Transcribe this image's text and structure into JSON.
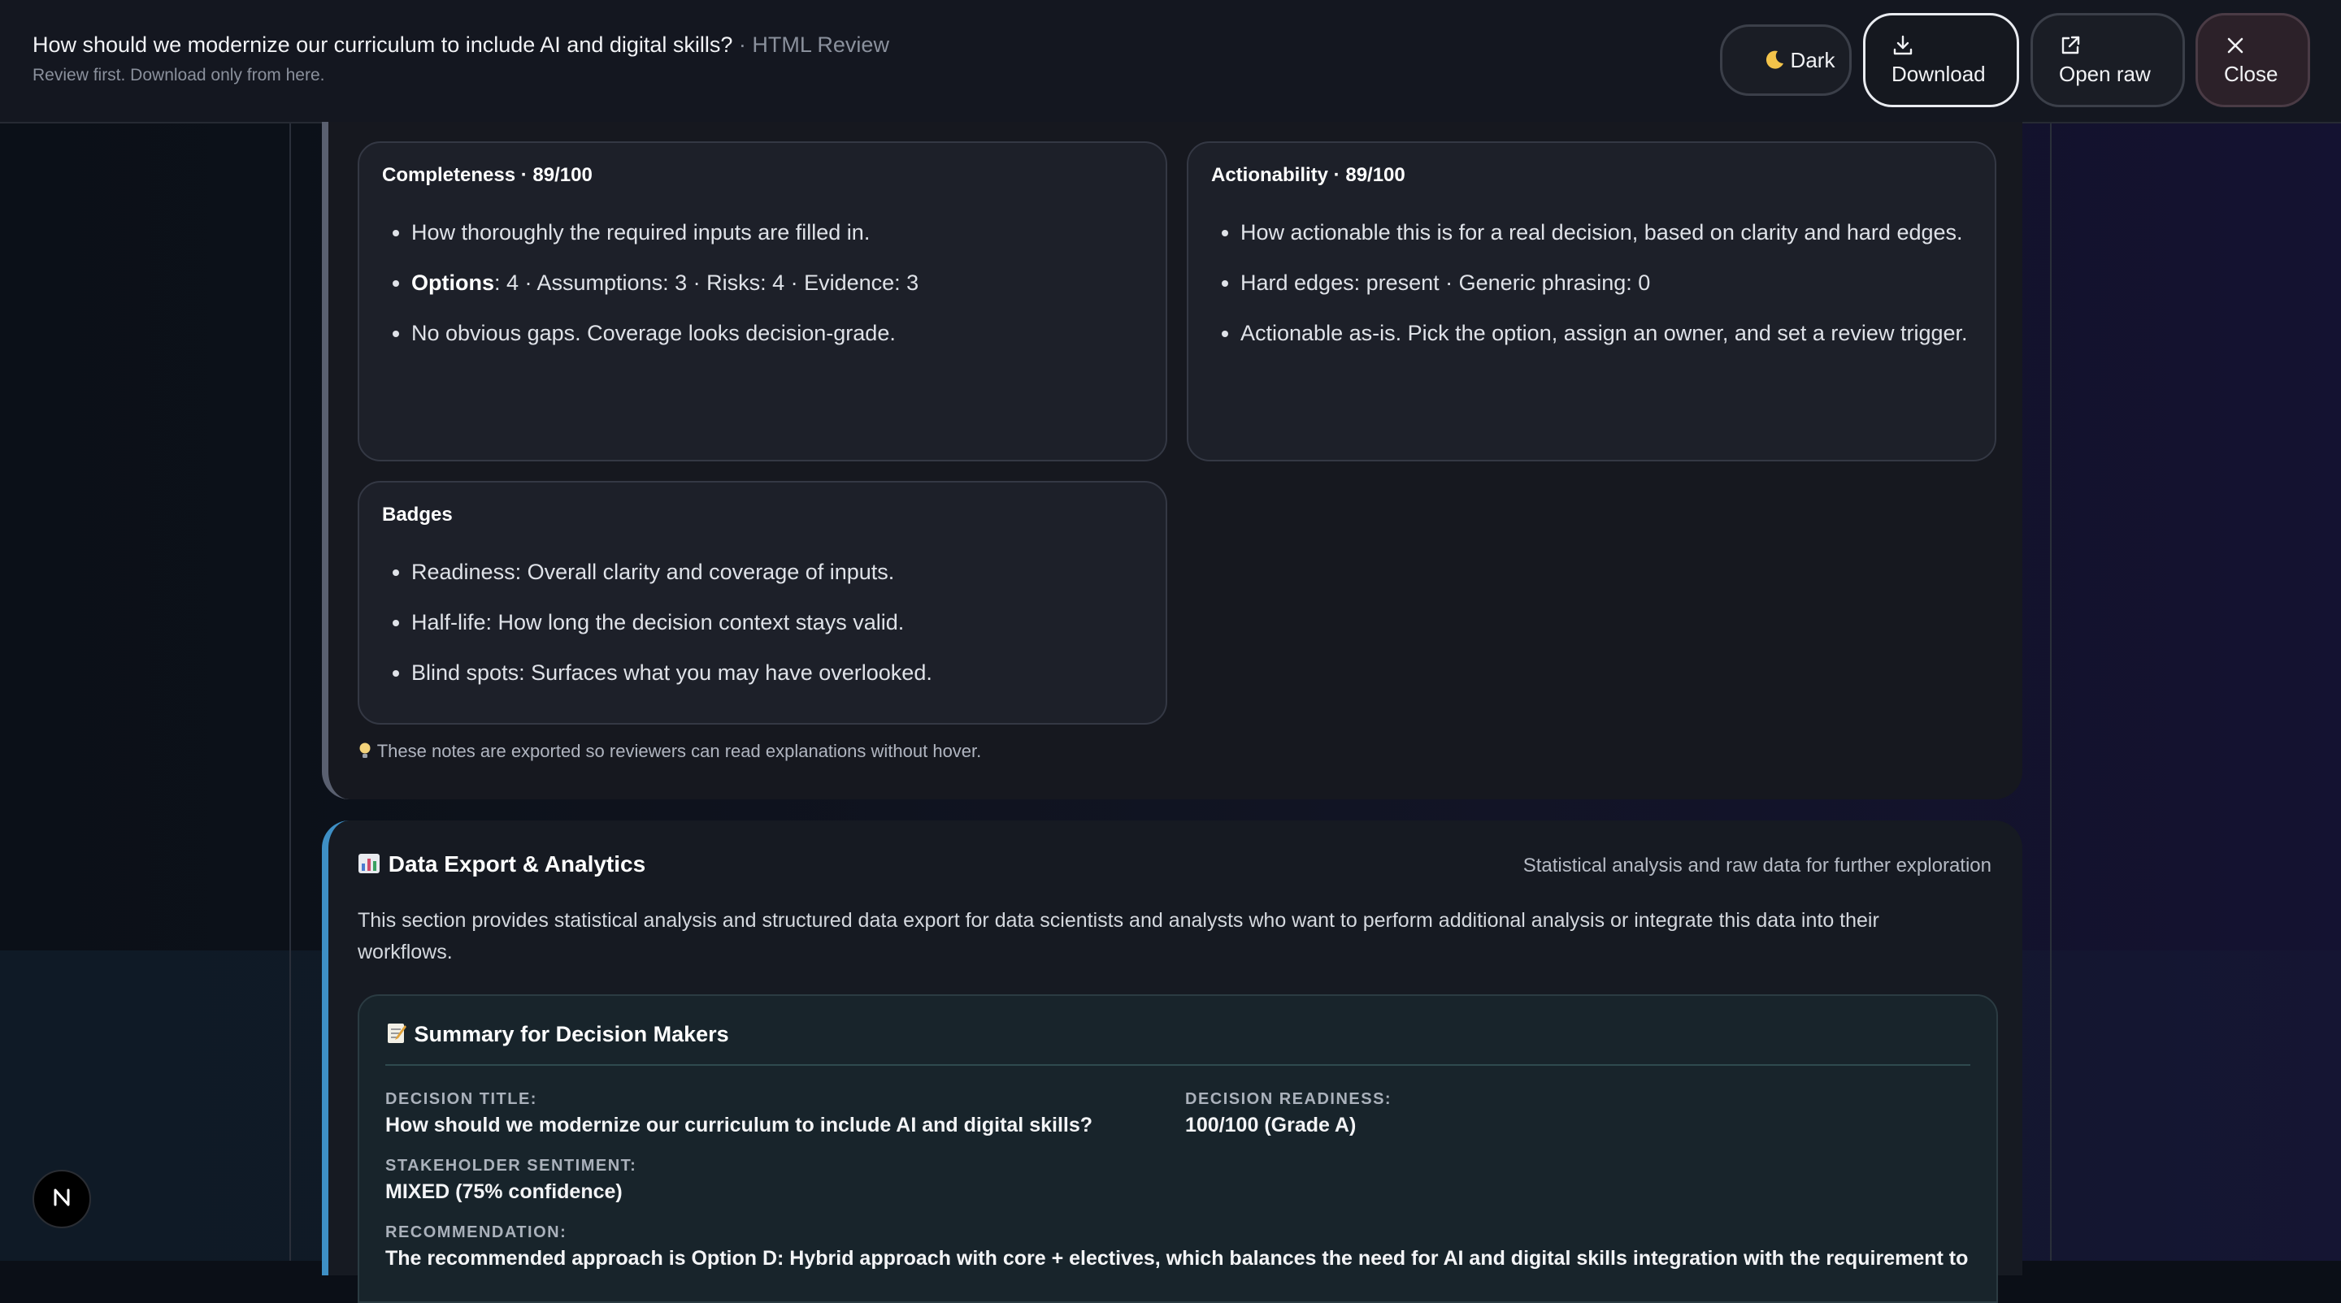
{
  "header": {
    "title": "How should we modernize our curriculum to include AI and digital skills?",
    "separator": " · ",
    "mode": "HTML Review",
    "subtitle": "Review first. Download only from here."
  },
  "toolbar": {
    "dark_label": "Dark",
    "download_label": "Download",
    "open_raw_label": "Open raw",
    "close_label": "Close"
  },
  "quality": {
    "completeness": {
      "title": "Completeness · 89/100",
      "items": [
        "How thoroughly the required inputs are filled in.",
        "No obvious gaps. Coverage looks decision-grade."
      ],
      "counts_bold": "Options",
      "counts_rest": ": 4 · Assumptions: 3 · Risks: 4 · Evidence: 3"
    },
    "actionability": {
      "title": "Actionability · 89/100",
      "items": [
        "How actionable this is for a real decision, based on clarity and hard edges.",
        "Hard edges: present · Generic phrasing: 0",
        "Actionable as-is. Pick the option, assign an owner, and set a review trigger."
      ]
    },
    "badges": {
      "title": "Badges",
      "items": [
        "Readiness: Overall clarity and coverage of inputs.",
        "Half-life: How long the decision context stays valid.",
        "Blind spots: Surfaces what you may have overlooked."
      ]
    },
    "note": "These notes are exported so reviewers can read explanations without hover."
  },
  "export": {
    "title": "Data Export & Analytics",
    "subtitle": "Statistical analysis and raw data for further exploration",
    "description": "This section provides statistical analysis and structured data export for data scientists and analysts who want to perform additional analysis or integrate this data into their workflows.",
    "summary": {
      "title": "Summary for Decision Makers",
      "decision_title_label": "DECISION TITLE:",
      "decision_title_value": "How should we modernize our curriculum to include AI and digital skills?",
      "readiness_label": "DECISION READINESS:",
      "readiness_value": "100/100 (Grade A)",
      "sentiment_label": "STAKEHOLDER SENTIMENT:",
      "sentiment_value": "MIXED (75% confidence)",
      "recommendation_label": "RECOMMENDATION:",
      "recommendation_value": "The recommended approach is Option D: Hybrid approach with core + electives, which balances the need for AI and digital skills integration with the requirement to"
    }
  },
  "floating_badge": "N",
  "colors": {
    "accent_quality": "#5a6070",
    "accent_export": "#3e8fc5"
  }
}
